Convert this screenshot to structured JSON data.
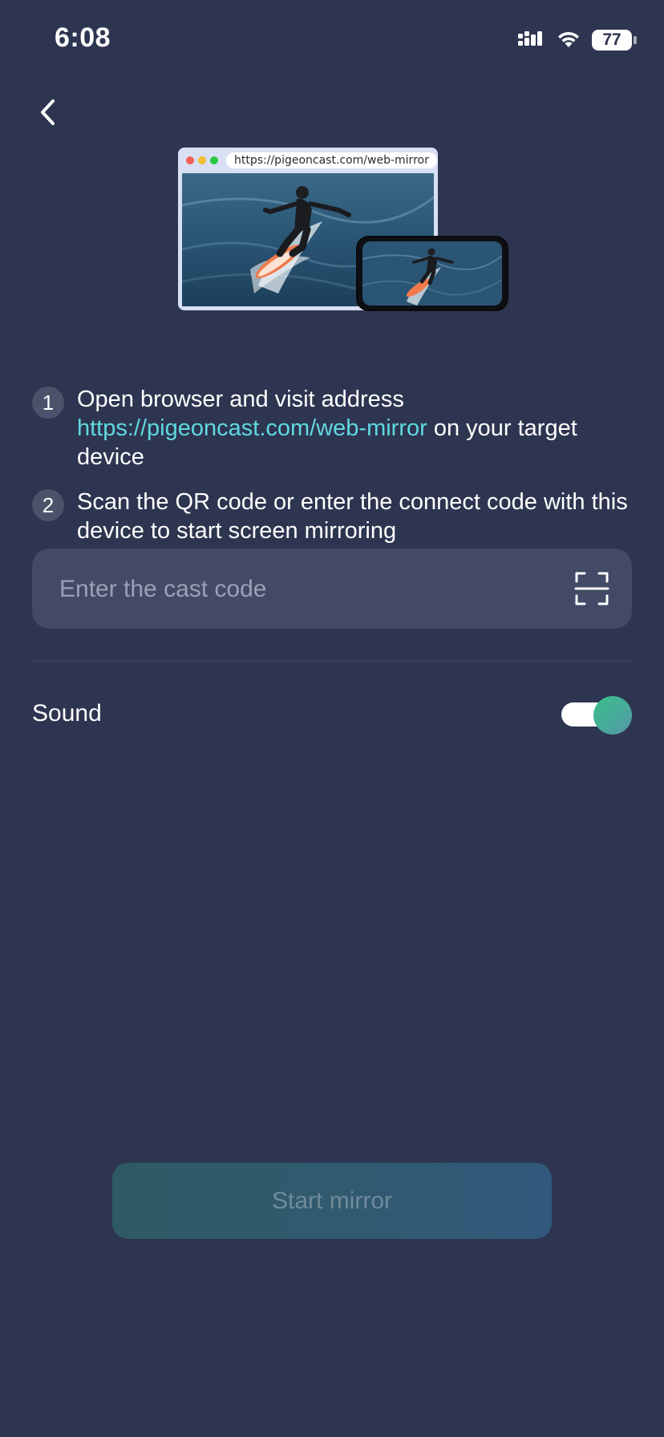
{
  "status_bar": {
    "time": "6:08",
    "battery_level": "77",
    "icons": [
      "signal-icon",
      "wifi-icon",
      "battery-icon"
    ]
  },
  "nav": {
    "back_icon": "chevron-left-icon"
  },
  "hero": {
    "url": "https://pigeoncast.com/web-mirror",
    "traffic_colors": [
      "#f25f57",
      "#f5bd2f",
      "#28c840"
    ]
  },
  "steps": [
    {
      "number": "1",
      "text_before": "Open browser and visit address ",
      "link": "https://pigeoncast.com/web-mirror",
      "text_after": " on your target device"
    },
    {
      "number": "2",
      "text": "Scan the QR code or enter the connect code with this device to start screen mirroring"
    }
  ],
  "cast_code": {
    "placeholder": "Enter the cast code",
    "value": "",
    "scan_icon": "qr-scan-icon"
  },
  "sound": {
    "label": "Sound",
    "enabled": true
  },
  "start_button": {
    "label": "Start mirror"
  },
  "colors": {
    "background": "#2e3550",
    "accent": "#5fd9e0",
    "input_bg": "#424a65",
    "toggle_on": "#3cc08a"
  }
}
